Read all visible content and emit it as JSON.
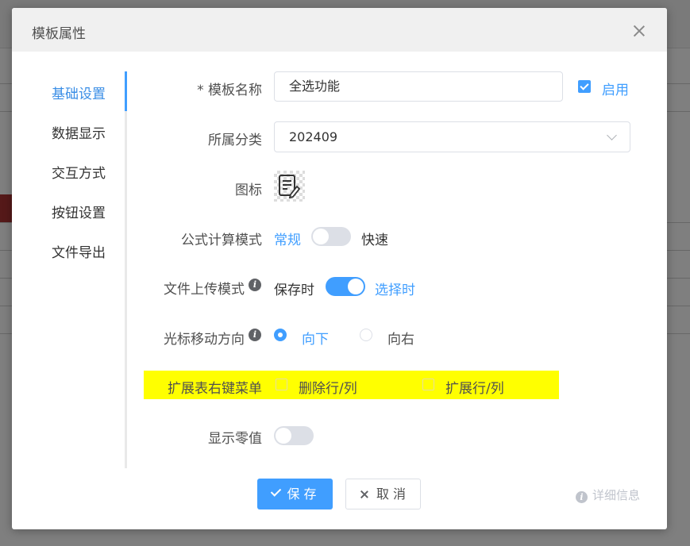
{
  "dialog": {
    "title": "模板属性"
  },
  "nav": {
    "items": [
      {
        "label": "基础设置",
        "active": true
      },
      {
        "label": "数据显示",
        "active": false
      },
      {
        "label": "交互方式",
        "active": false
      },
      {
        "label": "按钮设置",
        "active": false
      },
      {
        "label": "文件导出",
        "active": false
      }
    ]
  },
  "form": {
    "name": {
      "label": "* 模板名称",
      "value": "全选功能",
      "enable_label": "启用",
      "enabled": true
    },
    "category": {
      "label": "所属分类",
      "value": "202409"
    },
    "icon": {
      "label": "图标",
      "icon_name": "edit-document-icon"
    },
    "formula": {
      "label": "公式计算模式",
      "left": "常规",
      "right": "快速",
      "on": false
    },
    "upload": {
      "label": "文件上传模式",
      "left": "保存时",
      "right": "选择时",
      "on": true
    },
    "cursor": {
      "label": "光标移动方向",
      "option1": "向下",
      "option2": "向右",
      "selected": "向下"
    },
    "context_menu": {
      "label": "扩展表右键菜单",
      "option1": "删除行/列",
      "option2": "扩展行/列"
    },
    "zero": {
      "label": "显示零值",
      "on": false
    }
  },
  "footer": {
    "save": "保 存",
    "cancel": "取 消",
    "details": "详细信息"
  },
  "colors": {
    "accent": "#409eff",
    "highlight": "#ffff00"
  }
}
